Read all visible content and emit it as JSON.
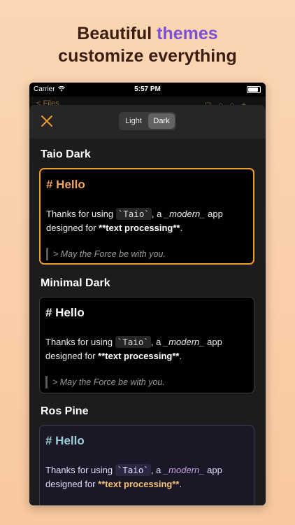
{
  "headline": {
    "line1_prefix": "Beautiful ",
    "line1_accent": "themes",
    "line2": "customize everything"
  },
  "status_bar": {
    "carrier": "Carrier",
    "time": "5:57 PM"
  },
  "behind": {
    "back_label": "< Files"
  },
  "segment": {
    "light": "Light",
    "dark": "Dark",
    "selected": "Dark"
  },
  "themes": [
    {
      "name": "Taio Dark",
      "heading": "# Hello",
      "text_before_code": "Thanks for using ",
      "code": "`Taio`",
      "text_after_code": ", a ",
      "italic": "_modern_",
      "text_after_italic": " app designed for ",
      "bold": "**text processing**",
      "text_end": ".",
      "quote": "> May the Force be with you.",
      "selected": true
    },
    {
      "name": "Minimal Dark",
      "heading": "# Hello",
      "text_before_code": "Thanks for using ",
      "code": "`Taio`",
      "text_after_code": ", a ",
      "italic": "_modern_",
      "text_after_italic": " app designed for ",
      "bold": "**text processing**",
      "text_end": ".",
      "quote": "> May the Force be with you.",
      "selected": false
    },
    {
      "name": "Ros Pine",
      "heading": "# Hello",
      "text_before_code": "Thanks for using ",
      "code": "`Taio`",
      "text_after_code": ", a ",
      "italic": "_modern_",
      "text_after_italic": " app designed for ",
      "bold": "**text processing**",
      "text_end": ".",
      "selected": false
    }
  ],
  "colors": {
    "accent": "#f09a28",
    "headline_accent": "#7b4fd6"
  }
}
